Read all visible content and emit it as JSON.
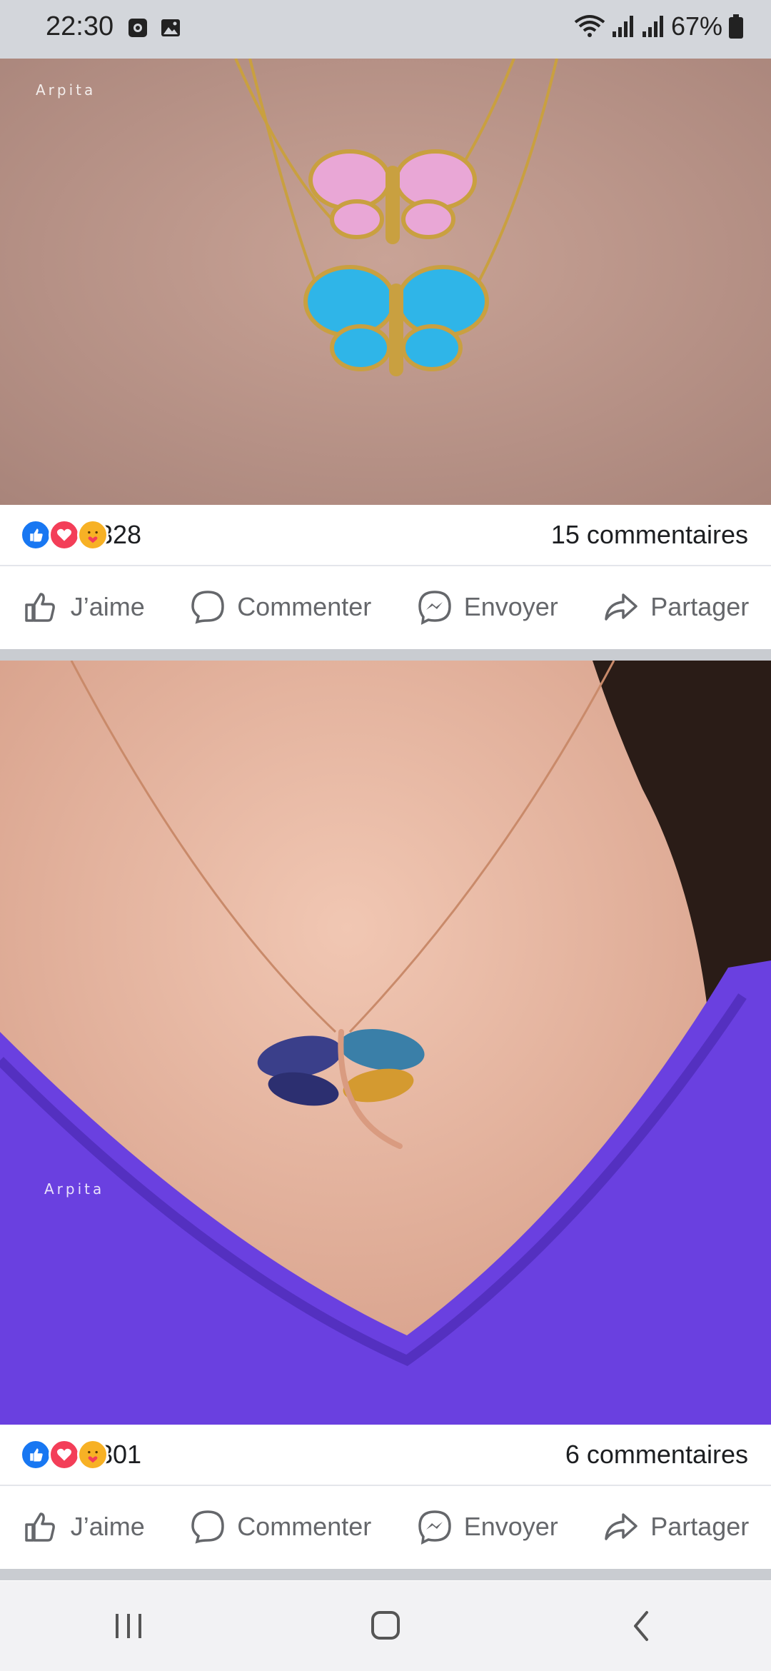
{
  "status_bar": {
    "time": "22:30",
    "battery": "67%",
    "icons": [
      "screen-record-icon",
      "image-icon",
      "wifi-icon",
      "signal-icon",
      "signal-icon",
      "battery-icon"
    ]
  },
  "posts": [
    {
      "watermark": "Arpita",
      "reaction_count": "328",
      "comments": "15 commentaires",
      "actions": {
        "like": "J’aime",
        "comment": "Commenter",
        "send": "Envoyer",
        "share": "Partager"
      }
    },
    {
      "watermark": "Arpita",
      "reaction_count": "301",
      "comments": "6 commentaires",
      "actions": {
        "like": "J’aime",
        "comment": "Commenter",
        "send": "Envoyer",
        "share": "Partager"
      }
    }
  ],
  "colors": {
    "like_blue": "#1877f2",
    "love_red": "#f33e58",
    "care_yellow": "#f7b125",
    "action_grey": "#65676b"
  }
}
